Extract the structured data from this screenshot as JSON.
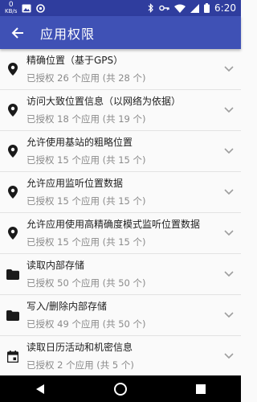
{
  "status_bar": {
    "kbs_value": "0",
    "kbs_unit": "KB/s",
    "time": "6:20"
  },
  "app_bar": {
    "title": "应用权限"
  },
  "permissions": [
    {
      "icon": "location-pin-icon",
      "title": "精确位置（基于GPS）",
      "subtitle": "已授权 26 个应用 (共 28 个)"
    },
    {
      "icon": "location-pin-icon",
      "title": "访问大致位置信息（以网络为依据）",
      "subtitle": "已授权 18 个应用 (共 19 个)"
    },
    {
      "icon": "location-pin-icon",
      "title": "允许使用基站的粗略位置",
      "subtitle": "已授权 15 个应用 (共 15 个)"
    },
    {
      "icon": "location-pin-icon",
      "title": "允许应用监听位置数据",
      "subtitle": "已授权 15 个应用 (共 15 个)"
    },
    {
      "icon": "location-pin-icon",
      "title": "允许应用使用高精确度模式监听位置数据",
      "subtitle": "已授权 15 个应用 (共 15 个)"
    },
    {
      "icon": "folder-icon",
      "title": "读取内部存储",
      "subtitle": "已授权 50 个应用 (共 50 个)"
    },
    {
      "icon": "folder-icon",
      "title": "写入/删除内部存储",
      "subtitle": "已授权 49 个应用 (共 50 个)"
    },
    {
      "icon": "calendar-icon",
      "title": "读取日历活动和机密信息",
      "subtitle": "已授权 2 个应用 (共 5 个)"
    }
  ],
  "colors": {
    "status_bar": "#2f3d9e",
    "app_bar": "#3f51b5",
    "title_text": "#212121",
    "subtitle_text": "#8a8a8a"
  }
}
